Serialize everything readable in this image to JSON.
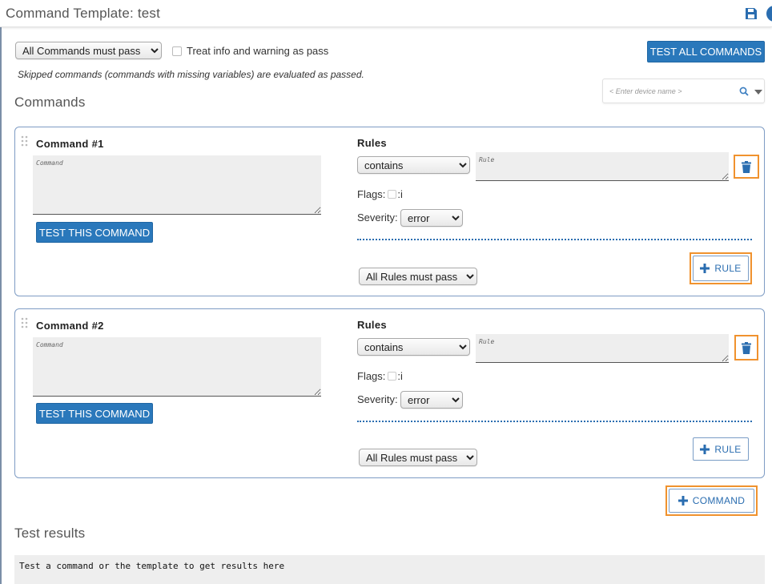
{
  "header": {
    "title": "Command Template: test",
    "save_icon": "save-icon",
    "info_icon": "info-icon"
  },
  "toolbar": {
    "pass_mode": {
      "selected": "All Commands must pass",
      "options": [
        "All Commands must pass"
      ]
    },
    "treat_info_label": "Treat info and warning as pass",
    "test_all_label": "TEST ALL COMMANDS",
    "skipped_note": "Skipped commands (commands with missing variables) are evaluated as passed."
  },
  "device": {
    "placeholder": "< Enter device name >"
  },
  "commands_heading": "Commands",
  "commands": [
    {
      "title": "Command #1",
      "command_placeholder": "Command",
      "test_label": "TEST THIS COMMAND",
      "rules_label": "Rules",
      "rule_op": "contains",
      "rule_placeholder": "Rule",
      "flags_label": "Flags:",
      "flag_i_label": ":i",
      "severity_label": "Severity:",
      "severity": "error",
      "rules_pass": "All Rules must pass",
      "add_rule_label": "RULE"
    },
    {
      "title": "Command #2",
      "command_placeholder": "Command",
      "test_label": "TEST THIS COMMAND",
      "rules_label": "Rules",
      "rule_op": "contains",
      "rule_placeholder": "Rule",
      "flags_label": "Flags:",
      "flag_i_label": ":i",
      "severity_label": "Severity:",
      "severity": "error",
      "rules_pass": "All Rules must pass",
      "add_rule_label": "RULE"
    }
  ],
  "add_command_label": "COMMAND",
  "results": {
    "heading": "Test results",
    "placeholder_text": "Test a command or the template to get results here"
  },
  "colors": {
    "primary": "#2a78bb",
    "highlight": "#f0922e",
    "card_border": "#7e9cc4"
  }
}
